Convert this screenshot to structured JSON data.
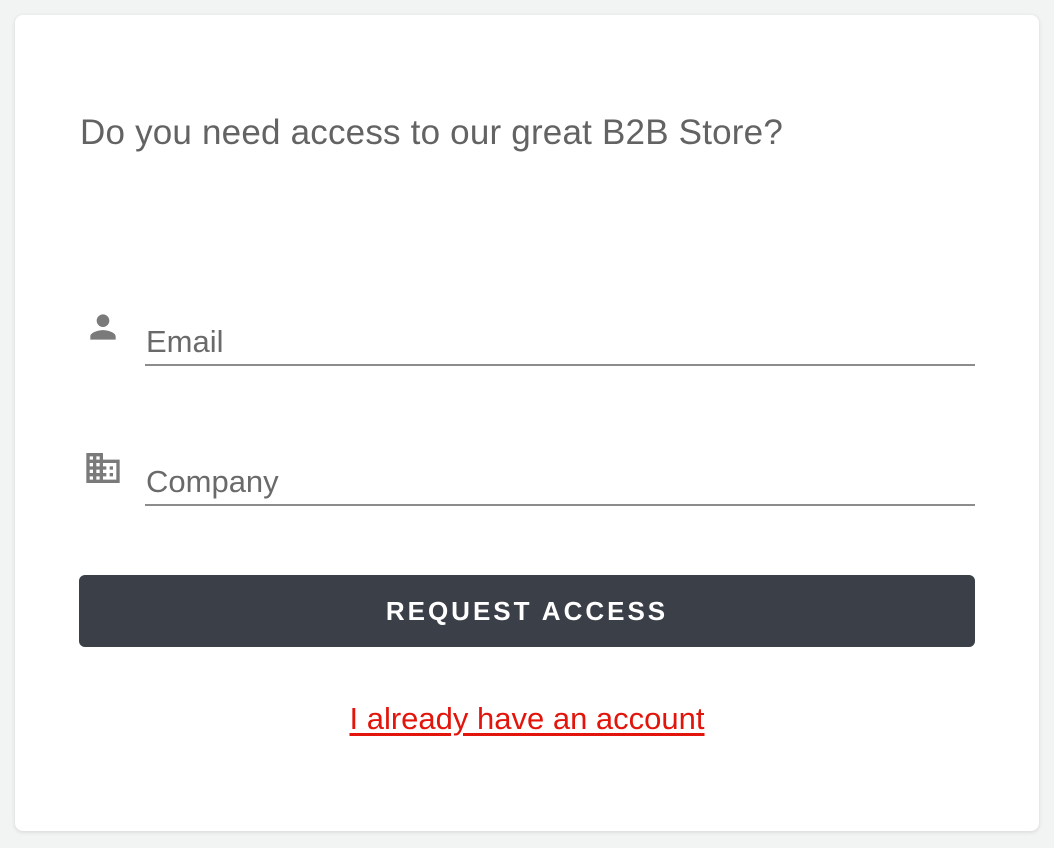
{
  "form": {
    "title": "Do you need access to our great B2B Store?",
    "email": {
      "placeholder": "Email",
      "value": "",
      "icon": "person-icon"
    },
    "company": {
      "placeholder": "Company",
      "value": "",
      "icon": "business-icon"
    },
    "submit_label": "REQUEST ACCESS",
    "login_link_label": "I already have an account"
  },
  "colors": {
    "page_background": "#f2f3f3",
    "card_background": "#ffffff",
    "button_background": "#3b3f47",
    "button_text": "#ffffff",
    "link": "#e2150c",
    "text": "#636363"
  }
}
